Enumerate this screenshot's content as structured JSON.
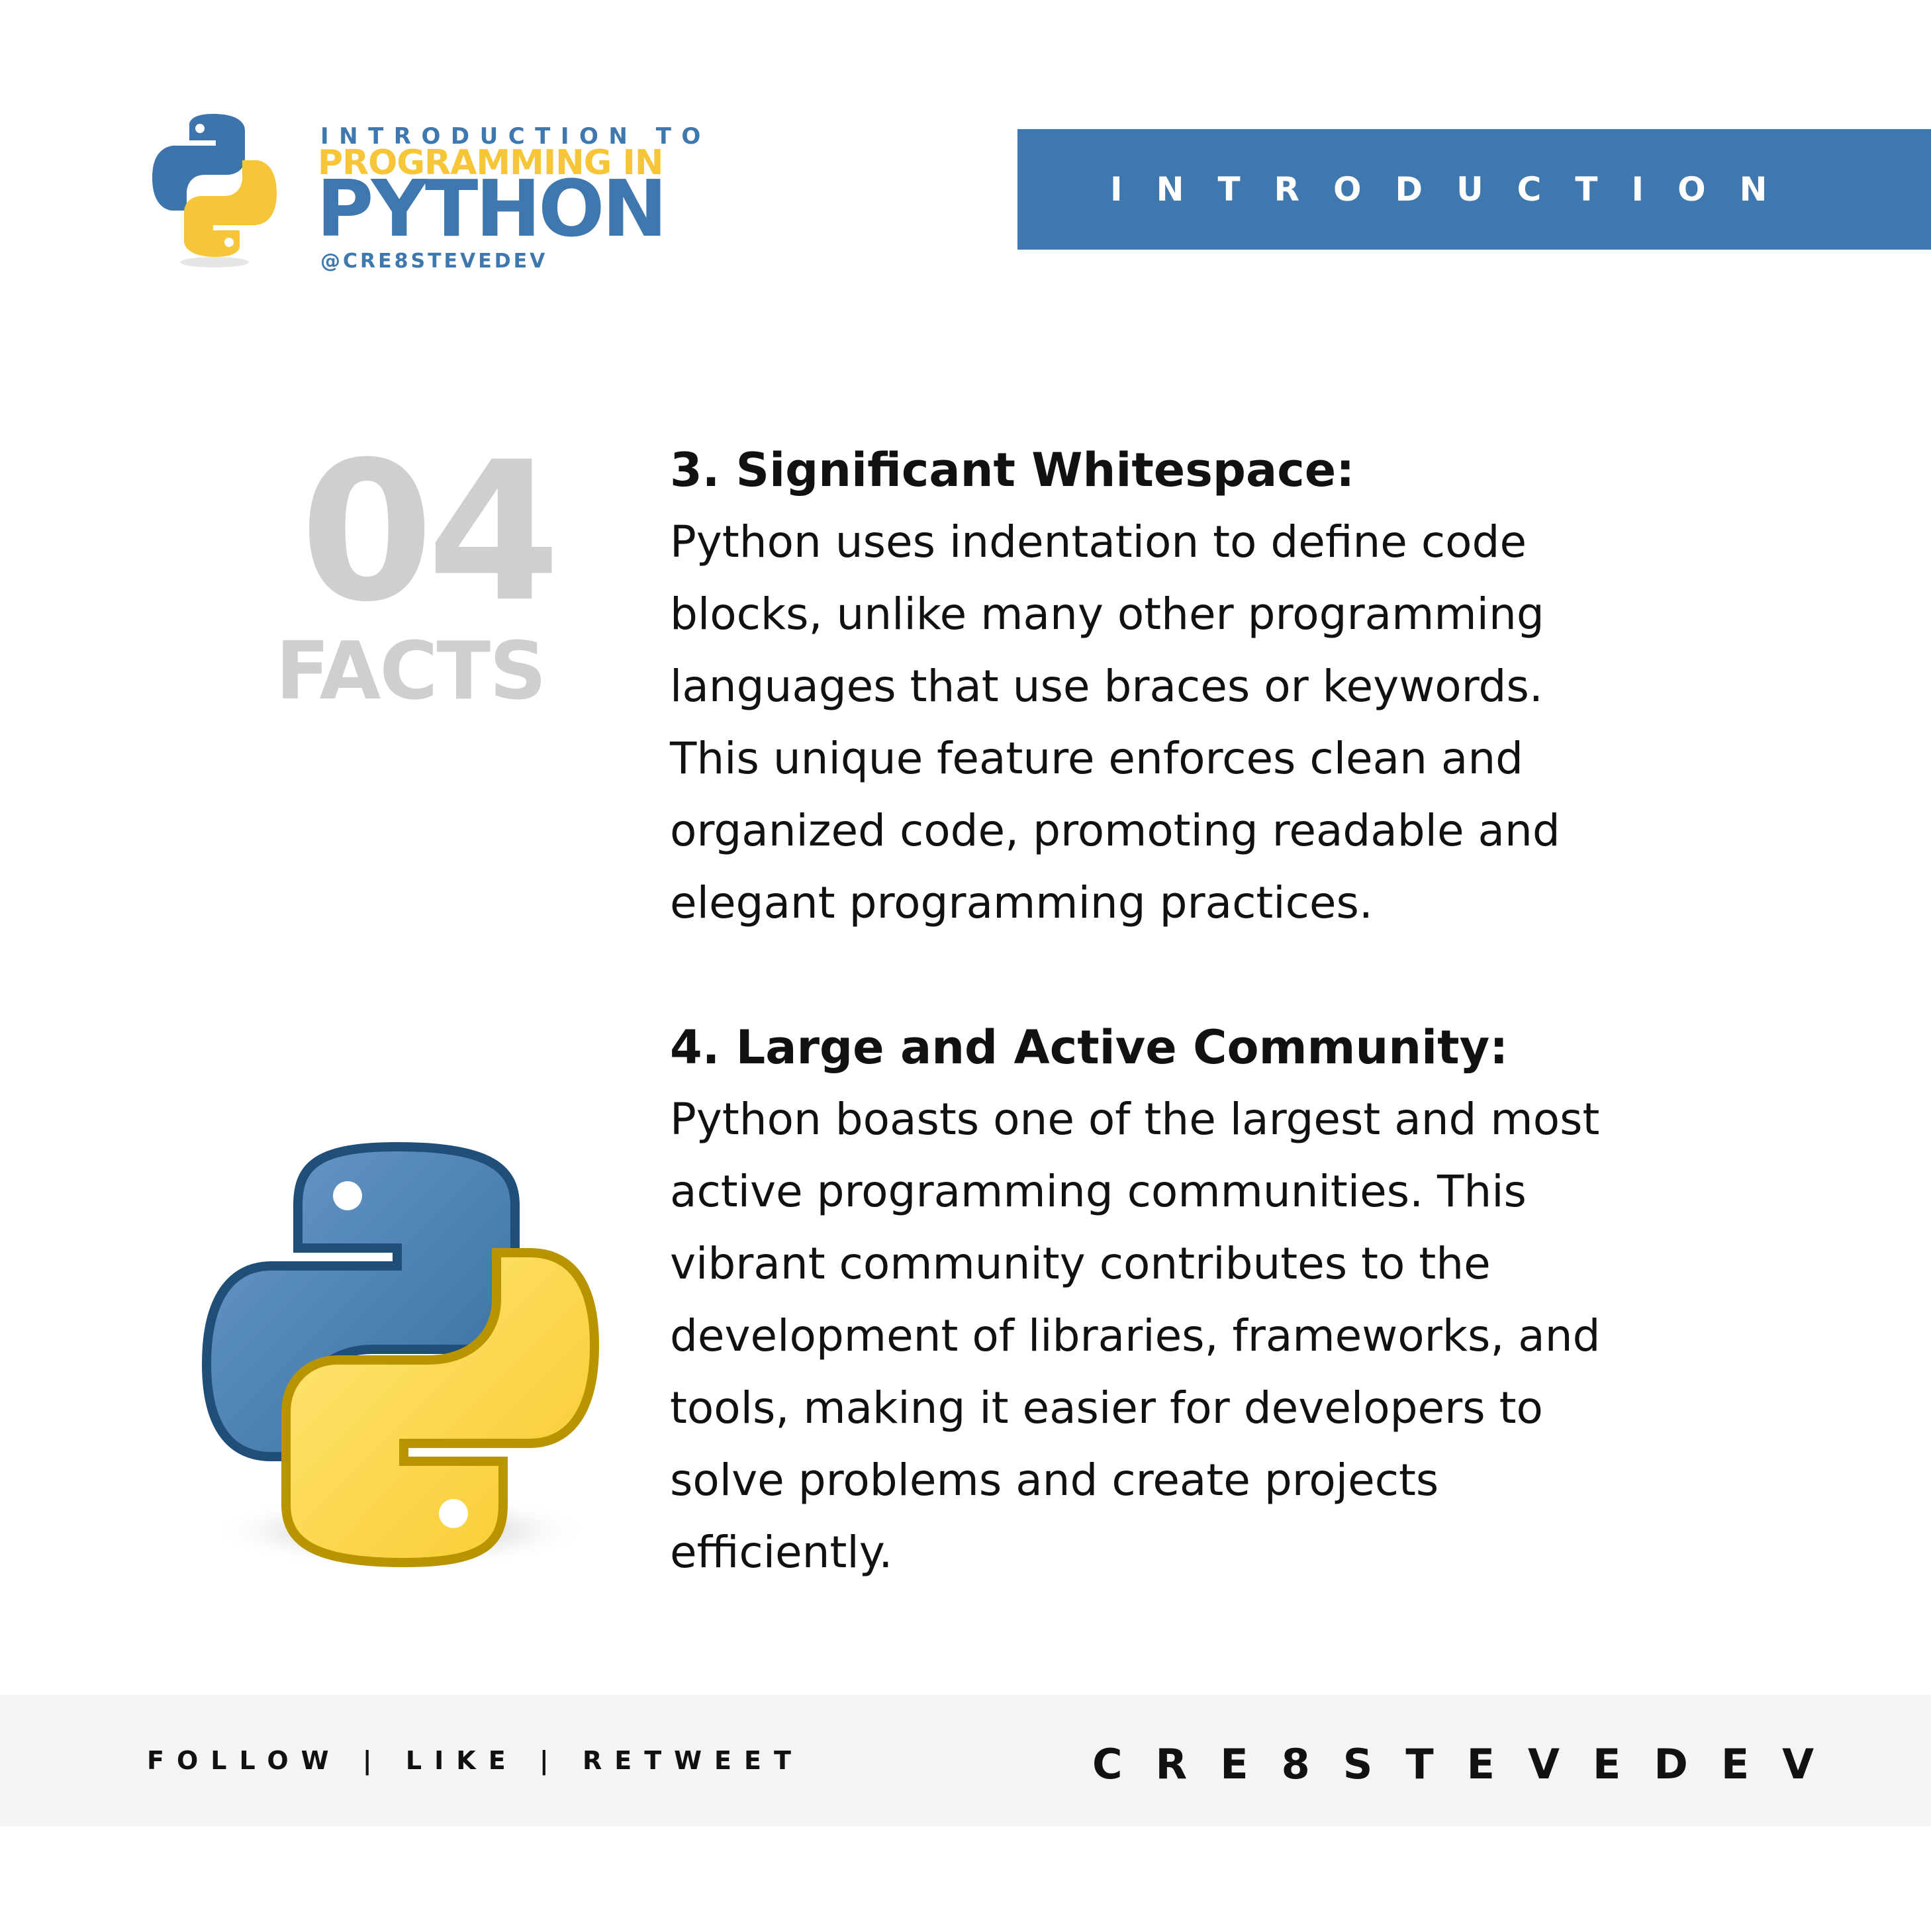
{
  "header": {
    "brand_pre": "INTRODUCTION TO",
    "brand_line2": "PROGRAMMING IN",
    "brand_line3": "PYTHON",
    "brand_handle": "@CRE8STEVEDEV",
    "logo_icon": "python-logo-icon"
  },
  "banner": {
    "label": "INTRODUCTION"
  },
  "counter": {
    "number": "04",
    "caption": "FACTS"
  },
  "facts": [
    {
      "title": "3. Significant Whitespace:",
      "lines": [
        "Python uses indentation to define code",
        "blocks, unlike many other programming",
        "languages that use braces or keywords.",
        "This unique feature enforces clean and",
        "organized code, promoting readable and",
        "elegant programming practices."
      ]
    },
    {
      "title": "4. Large and Active Community:",
      "lines": [
        "Python boasts one of the largest and most",
        "active programming communities. This",
        "vibrant community contributes to the",
        "development of libraries, frameworks, and",
        "tools, making it easier for developers to",
        "solve problems and create projects",
        "efficiently."
      ]
    }
  ],
  "footer": {
    "actions": "FOLLOW | LIKE | RETWEET",
    "brand": "CRE8STEVEDEV"
  },
  "colors": {
    "python_blue": "#3f78ae",
    "python_yellow": "#f7c638",
    "muted_gray": "#cfcfcf",
    "footer_bg": "#f4f4f4"
  }
}
